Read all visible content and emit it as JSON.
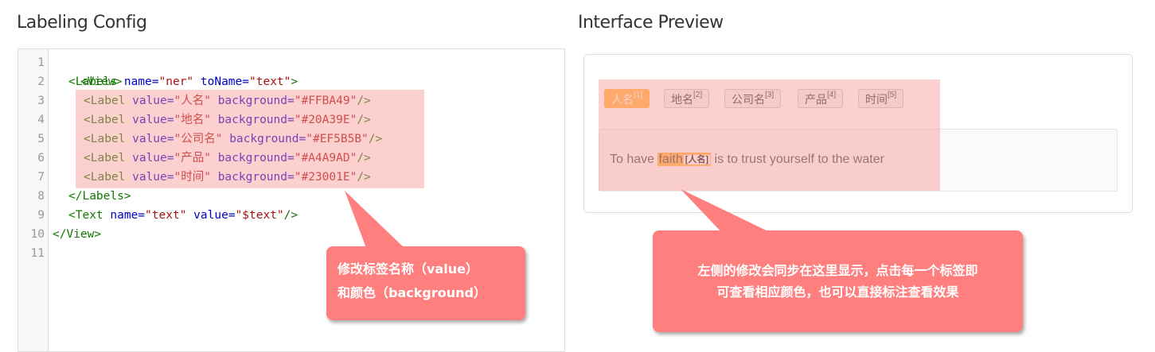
{
  "left_title": "Labeling Config",
  "right_title": "Interface Preview",
  "editor": {
    "line_numbers": [
      "1",
      "2",
      "3",
      "4",
      "5",
      "6",
      "7",
      "8",
      "9",
      "10",
      "11"
    ]
  },
  "config_lines": {
    "l1": {
      "tag": "<View>"
    },
    "l2": {
      "open": "<Labels ",
      "a1": "name=",
      "v1": "\"ner\"",
      "a2": " toName=",
      "v2": "\"text\"",
      "close": ">"
    },
    "labels": [
      {
        "open": "<Label ",
        "a1": "value=",
        "v1": "\"人名\"",
        "a2": " background=",
        "v2": "\"#FFBA49\"",
        "close": "/>"
      },
      {
        "open": "<Label ",
        "a1": "value=",
        "v1": "\"地名\"",
        "a2": " background=",
        "v2": "\"#20A39E\"",
        "close": "/>"
      },
      {
        "open": "<Label ",
        "a1": "value=",
        "v1": "\"公司名\"",
        "a2": " background=",
        "v2": "\"#EF5B5B\"",
        "close": "/>"
      },
      {
        "open": "<Label ",
        "a1": "value=",
        "v1": "\"产品\"",
        "a2": " background=",
        "v2": "\"#A4A9AD\"",
        "close": "/>"
      },
      {
        "open": "<Label ",
        "a1": "value=",
        "v1": "\"时间\"",
        "a2": " background=",
        "v2": "\"#23001E\"",
        "close": "/>"
      }
    ],
    "l8": {
      "tag": "</Labels>"
    },
    "l9": {
      "open": "<Text ",
      "a1": "name=",
      "v1": "\"text\"",
      "a2": " value=",
      "v2": "\"$text\"",
      "close": "/>"
    },
    "l10": {
      "tag": "</View>"
    }
  },
  "callout_left": {
    "line1": "修改标签名称（value）",
    "line2": "和颜色（background）"
  },
  "callout_right": {
    "line1": "左侧的修改会同步在这里显示，点击每一个标签即",
    "line2": "可查看相应颜色，也可以直接标注查看效果"
  },
  "preview": {
    "labels": [
      {
        "name": "人名",
        "hotkey": "[1]"
      },
      {
        "name": "地名",
        "hotkey": "[2]"
      },
      {
        "name": "公司名",
        "hotkey": "[3]"
      },
      {
        "name": "产品",
        "hotkey": "[4]"
      },
      {
        "name": "时间",
        "hotkey": "[5]"
      }
    ],
    "text_before": "To have ",
    "highlighted_word": "faith",
    "highlight_tag": "[人名]",
    "text_after": " is to trust yourself to the water"
  },
  "colors": {
    "active_label": "#FFBA49",
    "callout": "#FF7F7F"
  }
}
